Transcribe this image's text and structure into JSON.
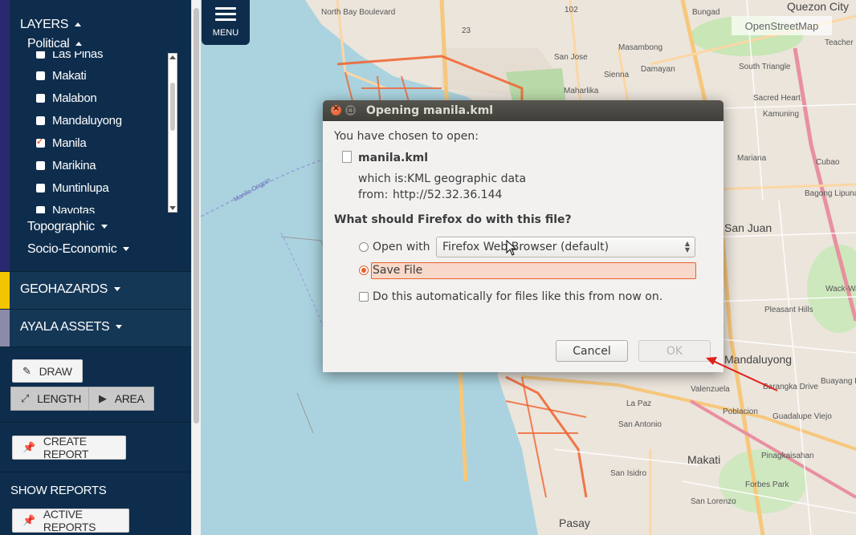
{
  "sidebar": {
    "layers_label": "LAYERS",
    "political_label": "Political",
    "layer_items": [
      {
        "label": "Las Piñas",
        "checked": false
      },
      {
        "label": "Makati",
        "checked": false
      },
      {
        "label": "Malabon",
        "checked": false
      },
      {
        "label": "Mandaluyong",
        "checked": false
      },
      {
        "label": "Manila",
        "checked": true
      },
      {
        "label": "Marikina",
        "checked": false
      },
      {
        "label": "Muntinlupa",
        "checked": false
      },
      {
        "label": "Navotas",
        "checked": false
      }
    ],
    "topographic_label": "Topographic",
    "socio_economic_label": "Socio-Economic",
    "geohazards_label": "GEOHAZARDS",
    "ayala_assets_label": "AYALA ASSETS",
    "draw_label": "DRAW",
    "length_label": "LENGTH",
    "area_label": "AREA",
    "create_report_label": "CREATE REPORT",
    "show_reports_label": "SHOW REPORTS",
    "active_reports_label": "ACTIVE REPORTS",
    "colors": {
      "panel": "#0e2d4c",
      "layers_stripe": "#2a2870",
      "geohazards_stripe": "#f2c500",
      "ayala_stripe": "#8c8aa8"
    }
  },
  "map": {
    "menu_label": "MENU",
    "attribution": "OpenStreetMap",
    "labels": [
      "North Bay Boulevard",
      "102",
      "Bungad",
      "Quezon City",
      "Teacher",
      "23",
      "Masambong",
      "San Jose",
      "Damayan",
      "Sienna",
      "Maharlika",
      "South Triangle",
      "Sacred Heart",
      "Kamuning",
      "Cubao",
      "Mariana",
      "Bagong Lipunan",
      "San Juan",
      "Wack-Wack Greenhills",
      "Pleasant Hills",
      "Mandaluyong",
      "Buayang Bato",
      "Barangka Drive",
      "Valenzuela",
      "Poblacion",
      "Guadalupe Viejo",
      "La Paz",
      "San Antonio",
      "Makati",
      "Pinagkaisahan",
      "San Isidro",
      "Forbes Park",
      "San Lorenzo",
      "Pasay",
      "Manila Ongpin"
    ]
  },
  "dialog": {
    "title": "Opening manila.kml",
    "intro": "You have chosen to open:",
    "filename": "manila.kml",
    "which_is_label": "which is:",
    "which_is_value": "KML geographic data",
    "from_label": "from:",
    "from_value": "http://52.32.36.144",
    "question": "What should Firefox do with this file?",
    "open_with_label": "Open with",
    "open_with_value": "Firefox Web Browser (default)",
    "save_file_label": "Save File",
    "auto_label": "Do this automatically for files like this from now on.",
    "cancel_label": "Cancel",
    "ok_label": "OK",
    "selected_option": "save_file",
    "ok_enabled": false
  },
  "annotation": {
    "arrow_color": "#e0201b"
  }
}
